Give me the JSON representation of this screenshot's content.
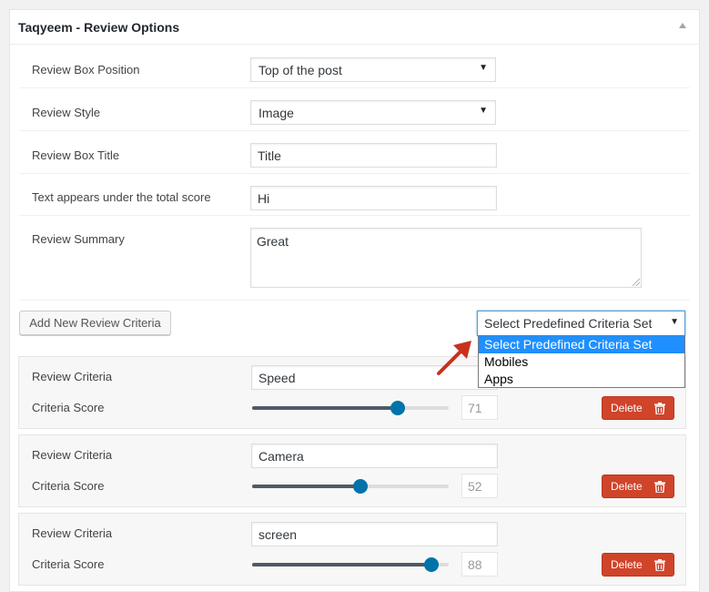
{
  "panel": {
    "title": "Taqyeem - Review Options"
  },
  "options": {
    "position": {
      "label": "Review Box Position",
      "value": "Top of the post"
    },
    "style": {
      "label": "Review Style",
      "value": "Image"
    },
    "box_title": {
      "label": "Review Box Title",
      "value": "Title"
    },
    "under_score": {
      "label": "Text appears under the total score",
      "value": "Hi"
    },
    "summary": {
      "label": "Review Summary",
      "value": "Great"
    }
  },
  "add_button": {
    "label": "Add New Review Criteria"
  },
  "predefined": {
    "value": "Select Predefined Criteria Set",
    "options": [
      "Select Predefined Criteria Set",
      "Mobiles",
      "Apps"
    ],
    "highlight_color": "#1e90ff"
  },
  "criteria": [
    {
      "criteria_label": "Review Criteria",
      "name": "Speed",
      "score_label": "Criteria Score",
      "score": "71",
      "delete_label": "Delete"
    },
    {
      "criteria_label": "Review Criteria",
      "name": "Camera",
      "score_label": "Criteria Score",
      "score": "52",
      "delete_label": "Delete"
    },
    {
      "criteria_label": "Review Criteria",
      "name": "screen",
      "score_label": "Criteria Score",
      "score": "88",
      "delete_label": "Delete"
    }
  ],
  "colors": {
    "accent": "#0073aa",
    "delete": "#d0442a",
    "arrow": "#c8321c"
  },
  "icons": {
    "toggle": "triangle-up-icon",
    "trash": "trash-icon",
    "pointer": "red-arrow-icon"
  }
}
